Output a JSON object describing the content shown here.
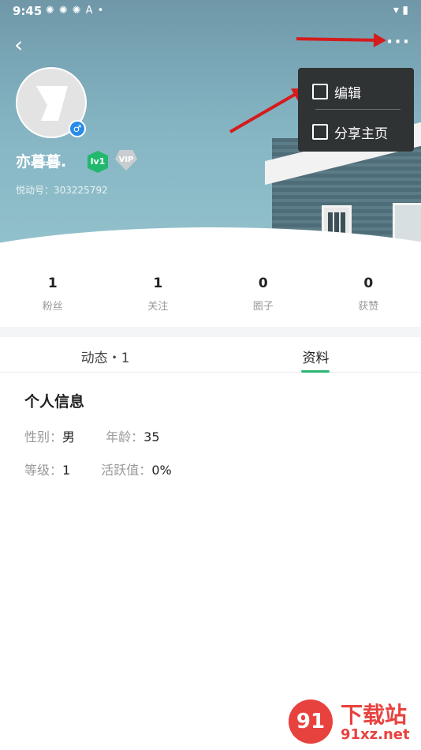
{
  "status_bar": {
    "time": "9:45",
    "left_icons": "✺✺✺A•",
    "right_icons": "▾ ▮"
  },
  "header": {
    "back_icon": "‹",
    "more_icon": "···"
  },
  "profile": {
    "username": "亦暮暮.",
    "level_badge": "lv1",
    "vip_badge": "VIP",
    "user_id": "悦动号：303225792"
  },
  "menu": {
    "items": [
      {
        "label": "编辑"
      },
      {
        "label": "分享主页"
      }
    ]
  },
  "stats": [
    {
      "value": "1",
      "label": "粉丝"
    },
    {
      "value": "1",
      "label": "关注"
    },
    {
      "value": "0",
      "label": "圈子"
    },
    {
      "value": "0",
      "label": "获赞"
    }
  ],
  "tabs": [
    {
      "label": "动态・1"
    },
    {
      "label": "资料"
    }
  ],
  "info": {
    "title": "个人信息",
    "gender_label": "性别：",
    "gender_value": "男",
    "age_label": "年龄：",
    "age_value": "35",
    "grade_label": "等级：",
    "grade_value": "1",
    "activity_label": "活跃值：",
    "activity_value": "0%"
  },
  "watermark": {
    "logo": "91",
    "text": "下载站",
    "url": "91xz.net"
  },
  "colors": {
    "accent": "#2bb674",
    "menu_bg": "#2f3334",
    "annotation_arrow": "#d51b1b"
  }
}
